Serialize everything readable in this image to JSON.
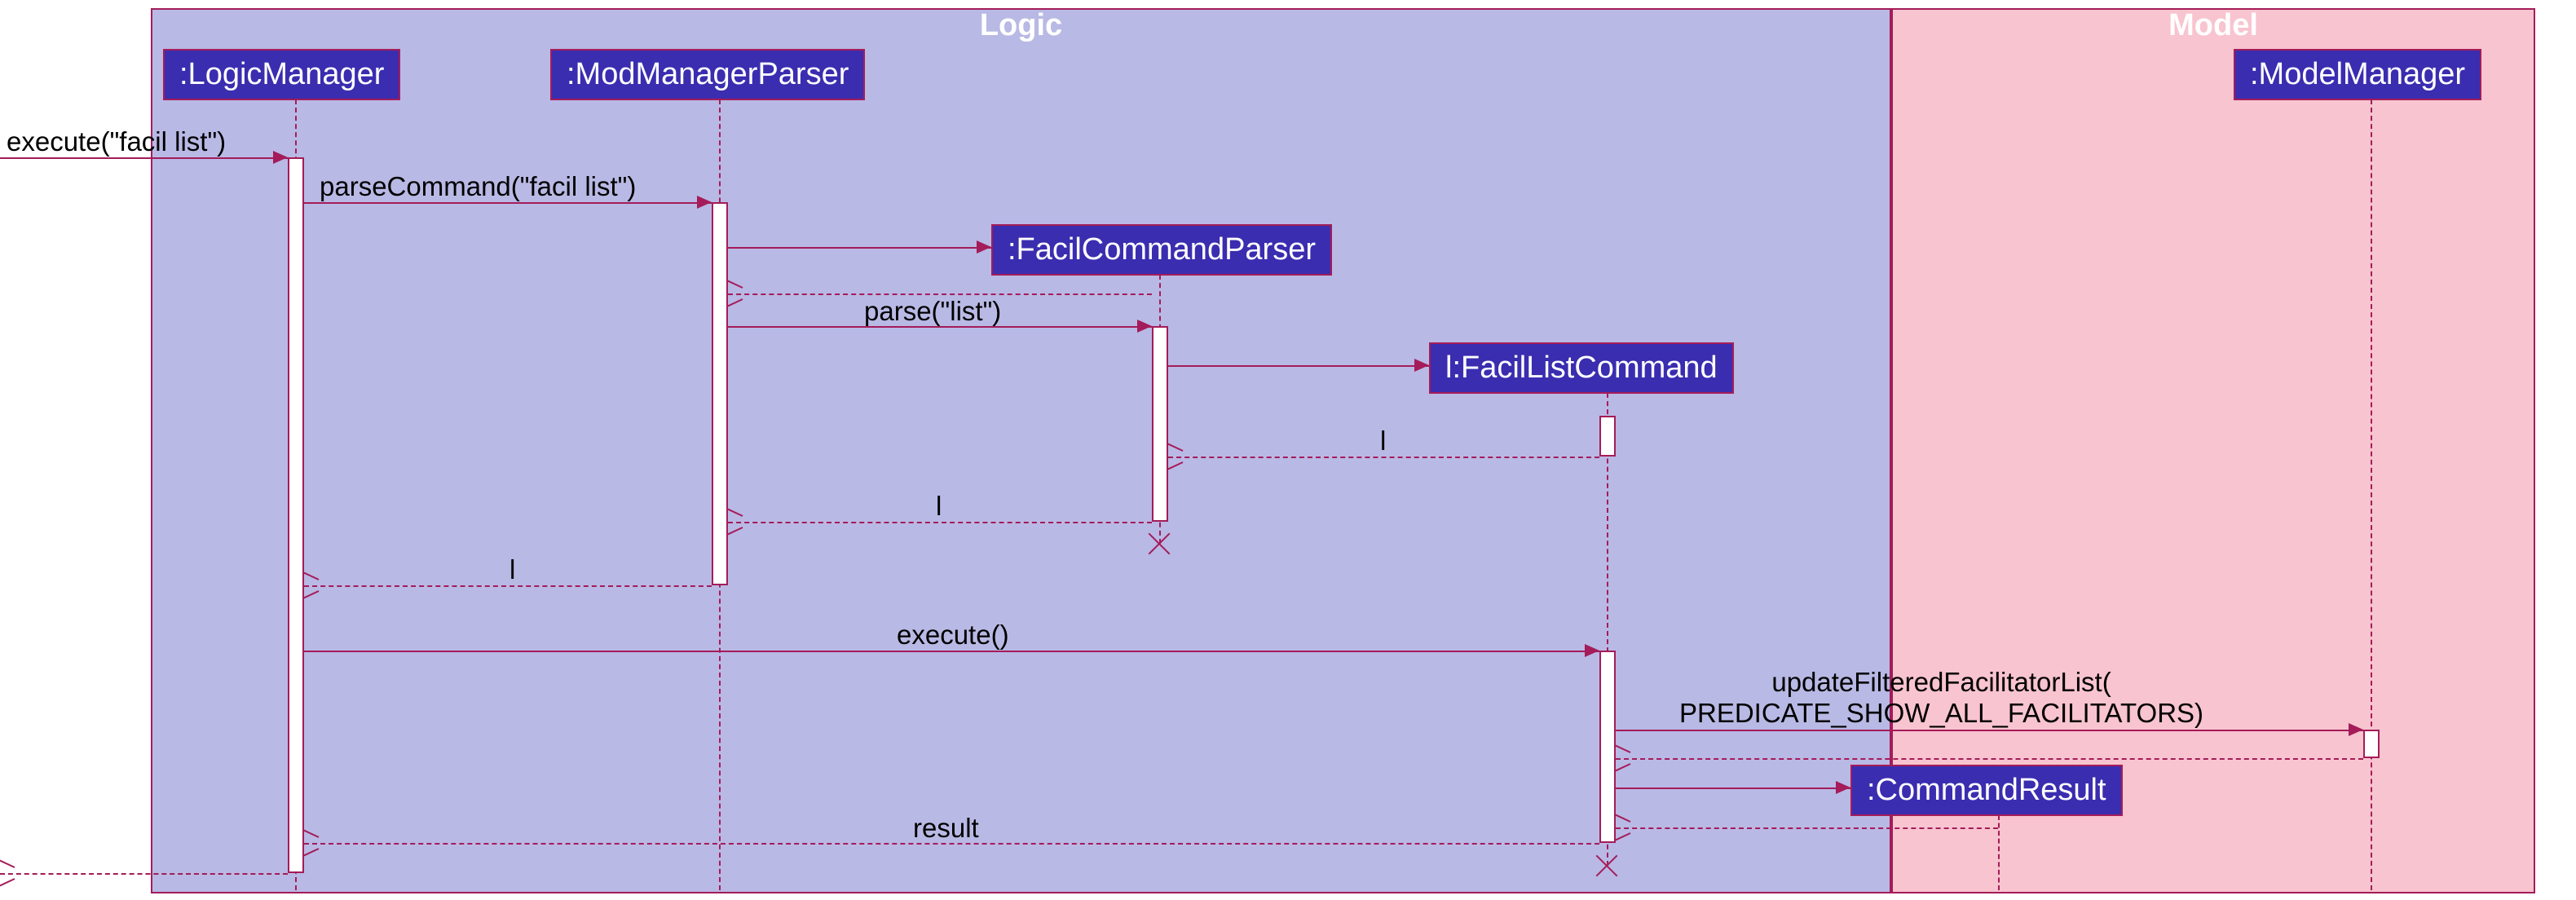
{
  "packages": {
    "logic": "Logic",
    "model": "Model"
  },
  "participants": {
    "logicManager": ":LogicManager",
    "modManagerParser": ":ModManagerParser",
    "facilCommandParser": ":FacilCommandParser",
    "facilListCommand": "l:FacilListCommand",
    "commandResult": ":CommandResult",
    "modelManager": ":ModelManager"
  },
  "messages": {
    "execute": "execute(\"facil list\")",
    "parseCommand": "parseCommand(\"facil list\")",
    "parse": "parse(\"list\")",
    "executeCall": "execute()",
    "updateFiltered": "updateFilteredFacilitatorList(\nPREDICATE_SHOW_ALL_FACILITATORS)",
    "returnL1": "l",
    "returnL2": "l",
    "returnL3": "l",
    "result": "result"
  }
}
